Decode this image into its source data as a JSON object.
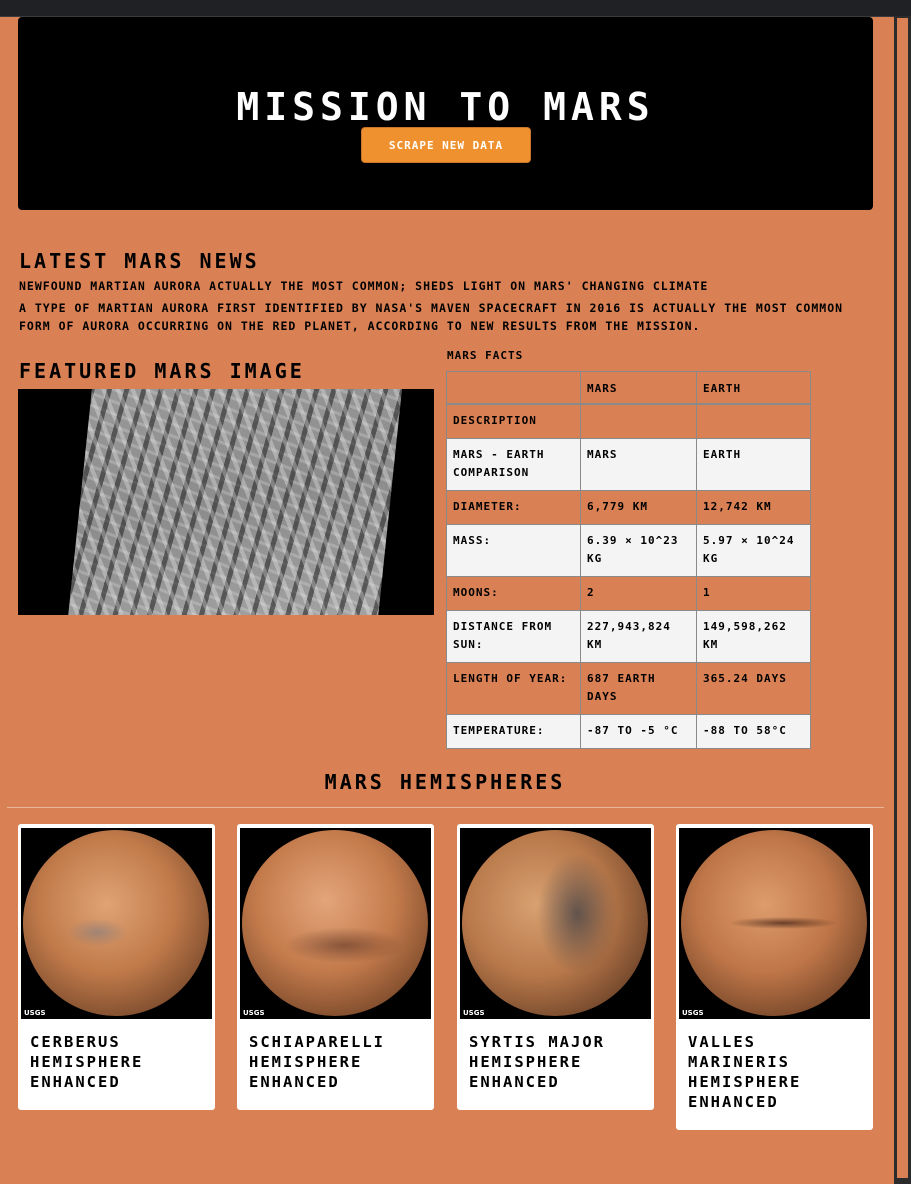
{
  "header": {
    "title": "MISSION TO MARS",
    "scrape_button": "SCRAPE NEW DATA"
  },
  "news": {
    "heading": "LATEST MARS NEWS",
    "title": "NEWFOUND MARTIAN AURORA ACTUALLY THE MOST COMMON; SHEDS LIGHT ON MARS' CHANGING CLIMATE",
    "paragraph": "A TYPE OF MARTIAN AURORA FIRST IDENTIFIED BY NASA'S MAVEN SPACECRAFT IN 2016 IS ACTUALLY THE MOST COMMON FORM OF AURORA OCCURRING ON THE RED PLANET, ACCORDING TO NEW RESULTS FROM THE MISSION."
  },
  "featured": {
    "heading": "FEATURED MARS IMAGE"
  },
  "facts": {
    "caption": "MARS FACTS",
    "headers": [
      "",
      "MARS",
      "EARTH"
    ],
    "rows": [
      [
        "DESCRIPTION",
        "",
        ""
      ],
      [
        "MARS - EARTH COMPARISON",
        "MARS",
        "EARTH"
      ],
      [
        "DIAMETER:",
        "6,779 KM",
        "12,742 KM"
      ],
      [
        "MASS:",
        "6.39 × 10^23 KG",
        "5.97 × 10^24 KG"
      ],
      [
        "MOONS:",
        "2",
        "1"
      ],
      [
        "DISTANCE FROM SUN:",
        "227,943,824 KM",
        "149,598,262 KM"
      ],
      [
        "LENGTH OF YEAR:",
        "687 EARTH DAYS",
        "365.24 DAYS"
      ],
      [
        "TEMPERATURE:",
        "-87 TO -5 °C",
        "-88 TO 58°C"
      ]
    ]
  },
  "hemispheres": {
    "heading": "MARS HEMISPHERES",
    "logo_text": "USGS",
    "items": [
      {
        "title": "CERBERUS HEMISPHERE ENHANCED"
      },
      {
        "title": "SCHIAPARELLI HEMISPHERE ENHANCED"
      },
      {
        "title": "SYRTIS MAJOR HEMISPHERE ENHANCED"
      },
      {
        "title": "VALLES MARINERIS HEMISPHERE ENHANCED"
      }
    ]
  },
  "colors": {
    "page_background": "#d98155",
    "button": "#f0912f"
  }
}
